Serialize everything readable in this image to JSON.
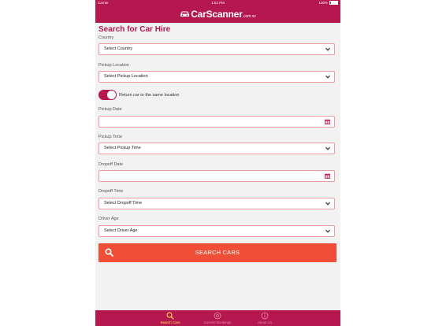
{
  "status_bar": {
    "carrier": "Carrier",
    "time": "1:52 PM",
    "battery": "100%"
  },
  "header": {
    "brand": "CarScanner",
    "suffix": ".com.sz"
  },
  "page_title": "Search for Car Hire",
  "form": {
    "country": {
      "label": "Country",
      "value": "Select Country"
    },
    "pickup_location": {
      "label": "Pickup Location",
      "value": "Select Pickup Location"
    },
    "return_toggle": {
      "label": "Return car to the same location",
      "on": true
    },
    "pickup_date": {
      "label": "Pickup Date",
      "value": ""
    },
    "pickup_time": {
      "label": "Pickup Time",
      "value": "Select Pickup Time"
    },
    "dropoff_date": {
      "label": "Dropoff Date",
      "value": ""
    },
    "dropoff_time": {
      "label": "Dropoff Time",
      "value": "Select Dropoff Time"
    },
    "driver_age": {
      "label": "Driver Age",
      "value": "Select Driver Age"
    }
  },
  "search_button": {
    "label": "SEARCH CARS",
    "color": "#f04e37"
  },
  "tabs": [
    {
      "label": "Search Cars",
      "icon": "search-icon",
      "active": true
    },
    {
      "label": "Current Bookings",
      "icon": "bookings-icon",
      "active": false
    },
    {
      "label": "About Us",
      "icon": "info-icon",
      "active": false
    }
  ],
  "colors": {
    "brand": "#b5174f",
    "field_border": "#ee9aa2",
    "active_tab": "#ffe65a"
  }
}
